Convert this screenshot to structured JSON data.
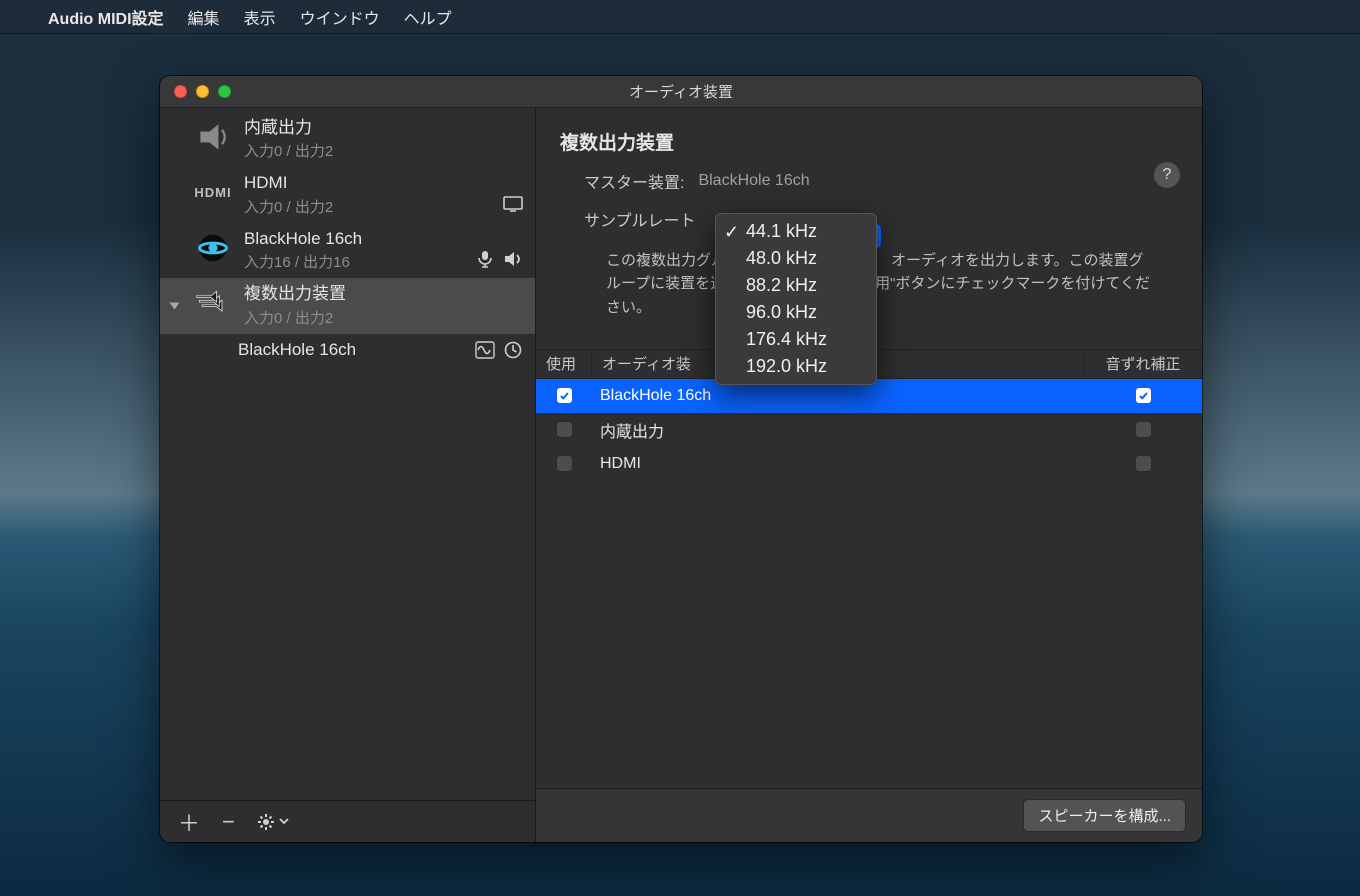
{
  "menubar": {
    "app": "Audio MIDI設定",
    "items": [
      "編集",
      "表示",
      "ウインドウ",
      "ヘルプ"
    ]
  },
  "window": {
    "title": "オーディオ装置"
  },
  "sidebar": {
    "devices": [
      {
        "name": "内蔵出力",
        "io": "入力0 / 出力2",
        "icon": "speaker"
      },
      {
        "name": "HDMI",
        "io": "入力0 / 出力2",
        "icon": "hdmi",
        "badges": [
          "display"
        ]
      },
      {
        "name": "BlackHole 16ch",
        "io": "入力16 / 出力16",
        "icon": "blackhole",
        "badges": [
          "mic",
          "sound"
        ]
      },
      {
        "name": "複数出力装置",
        "io": "入力0 / 出力2",
        "icon": "multi",
        "selected": true,
        "expanded": true,
        "children": [
          {
            "name": "BlackHole 16ch",
            "badges": [
              "wave",
              "clock"
            ]
          }
        ]
      }
    ]
  },
  "main": {
    "title": "複数出力装置",
    "master_label": "マスター装置:",
    "master_value": "BlackHole 16ch",
    "samplerate_label": "サンプルレート",
    "description_part1": "この複数出力グル",
    "description_part2": "オーディオを出力します。この装置グループに装置を追",
    "description_part3": "用\"ボタンにチェックマークを付けてください。",
    "table": {
      "headers": {
        "use": "使用",
        "name": "オーディオ装",
        "drift": "音ずれ補正"
      },
      "rows": [
        {
          "name": "BlackHole 16ch",
          "use": true,
          "drift": true,
          "selected": true
        },
        {
          "name": "内蔵出力",
          "use": false,
          "drift": false
        },
        {
          "name": "HDMI",
          "use": false,
          "drift": false
        }
      ]
    },
    "configure_button": "スピーカーを構成..."
  },
  "popup": {
    "options": [
      "44.1 kHz",
      "48.0 kHz",
      "88.2 kHz",
      "96.0 kHz",
      "176.4 kHz",
      "192.0 kHz"
    ],
    "selected_index": 0
  }
}
